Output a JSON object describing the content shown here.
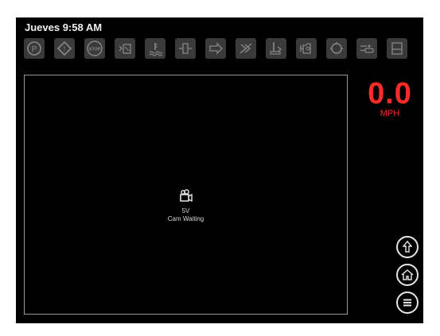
{
  "status": {
    "datetime": "Jueves 9:58 AM"
  },
  "indicators": [
    {
      "name": "park-brake-indicator",
      "icon": "park-brake-icon",
      "text": "P"
    },
    {
      "name": "warning-indicator",
      "icon": "warning-icon",
      "text": "!"
    },
    {
      "name": "stop-indicator",
      "icon": "stop-icon",
      "text": "STOP"
    },
    {
      "name": "washer-indicator",
      "icon": "washer-fluid-icon"
    },
    {
      "name": "coolant-indicator",
      "icon": "coolant-temperature-icon"
    },
    {
      "name": "filter-indicator",
      "icon": "fuel-filter-icon"
    },
    {
      "name": "transmission-indicator",
      "icon": "transmission-icon"
    },
    {
      "name": "tire-indicator",
      "icon": "tire-pressure-icon"
    },
    {
      "name": "oil-level-indicator",
      "icon": "oil-level-icon"
    },
    {
      "name": "engine-indicator",
      "icon": "check-engine-icon"
    },
    {
      "name": "steering-indicator",
      "icon": "steering-icon"
    },
    {
      "name": "hydraulic-indicator",
      "icon": "hydraulic-icon"
    },
    {
      "name": "seat-indicator",
      "icon": "seat-icon"
    }
  ],
  "camera": {
    "channel": "5V",
    "status": "Cam Waiting",
    "icon": "camera-icon"
  },
  "speed": {
    "value": "0.0",
    "unit": "MPH",
    "color": "#ff2a2a"
  },
  "nav": {
    "up_icon": "arrow-up-icon",
    "home_icon": "home-icon",
    "menu_icon": "menu-icon"
  },
  "colors": {
    "background": "#000000",
    "indicator_bg": "#3a3a3a",
    "speed": "#ff2a2a",
    "text": "#f0f0f0"
  }
}
